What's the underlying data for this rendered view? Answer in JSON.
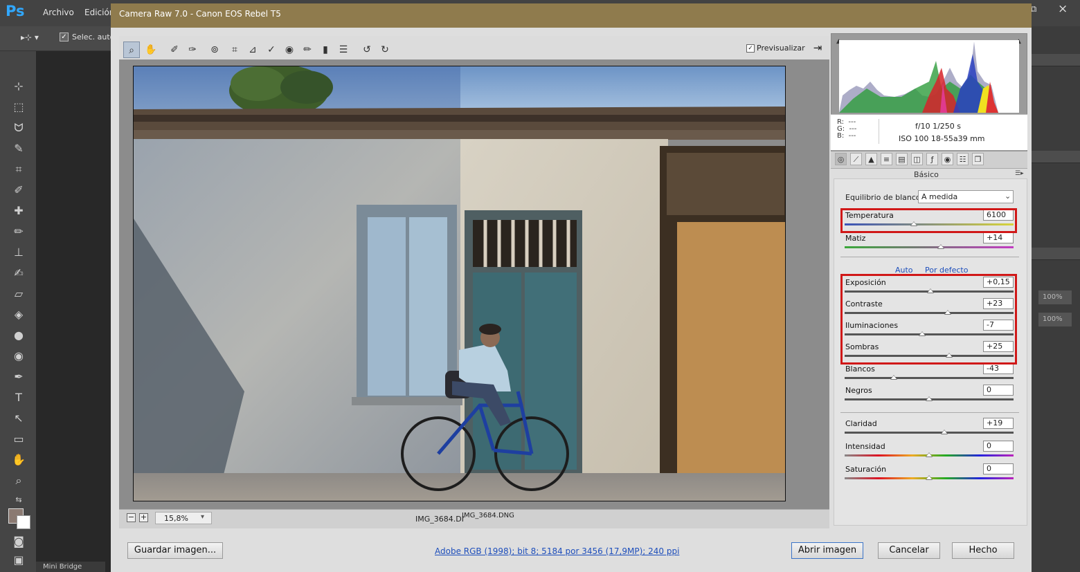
{
  "photoshop": {
    "logo": "Ps",
    "menu": [
      "Archivo",
      "Edición"
    ],
    "options_label": "Selec. auto.",
    "zoom_values": [
      "100%",
      "100%"
    ],
    "minibridge_tab": "Mini Bridge",
    "fg_color": "#8b7a72",
    "bg_color": "#ffffff"
  },
  "dialog": {
    "title": "Camera Raw 7.0 - Canon EOS Rebel T5",
    "tools": [
      "zoom-icon",
      "hand-icon",
      "white-balance-icon",
      "color-sampler-icon",
      "target-adjust-icon",
      "crop-icon",
      "straighten-icon",
      "spot-removal-icon",
      "red-eye-icon",
      "adjustment-brush-icon",
      "graduated-filter-icon",
      "preferences-icon",
      "rotate-left-icon",
      "rotate-right-icon"
    ],
    "preview_label": "Previsualizar",
    "preview_checked": true,
    "zoom_level": "15,8%",
    "filename_left": "IMG_3684.DNG",
    "filename_right": "IMG_3684.DNG",
    "workflow_link": "Adobe RGB (1998); bit 8; 5184 por 3456 (17,9MP); 240 ppi",
    "buttons": {
      "save": "Guardar imagen...",
      "open": "Abrir imagen",
      "cancel": "Cancelar",
      "done": "Hecho"
    }
  },
  "histogram": {
    "r": "R:  ---",
    "g": "G:  ---",
    "b": "B:  ---",
    "meta_line1": "f/10   1/250 s",
    "meta_line2": "ISO 100   18-55a39 mm"
  },
  "panel": {
    "title": "Básico",
    "tabs": [
      "basic-icon",
      "tone-curve-icon",
      "detail-icon",
      "hsl-icon",
      "split-toning-icon",
      "lens-icon",
      "fx-icon",
      "camera-calibration-icon",
      "presets-icon",
      "snapshots-icon"
    ],
    "wb_label": "Equilibrio de blancos:",
    "wb_value": "A medida",
    "auto_label": "Auto",
    "default_label": "Por defecto",
    "sliders": [
      {
        "label": "Temperatura",
        "value": "6100",
        "position": 0.41
      },
      {
        "label": "Matiz",
        "value": "+14",
        "position": 0.57
      },
      {
        "label": "Exposición",
        "value": "+0,15",
        "position": 0.51
      },
      {
        "label": "Contraste",
        "value": "+23",
        "position": 0.61
      },
      {
        "label": "Iluminaciones",
        "value": "-7",
        "position": 0.46
      },
      {
        "label": "Sombras",
        "value": "+25",
        "position": 0.62
      },
      {
        "label": "Blancos",
        "value": "-43",
        "position": 0.29
      },
      {
        "label": "Negros",
        "value": "0",
        "position": 0.5
      },
      {
        "label": "Claridad",
        "value": "+19",
        "position": 0.59
      },
      {
        "label": "Intensidad",
        "value": "0",
        "position": 0.5
      },
      {
        "label": "Saturación",
        "value": "0",
        "position": 0.5
      }
    ]
  }
}
